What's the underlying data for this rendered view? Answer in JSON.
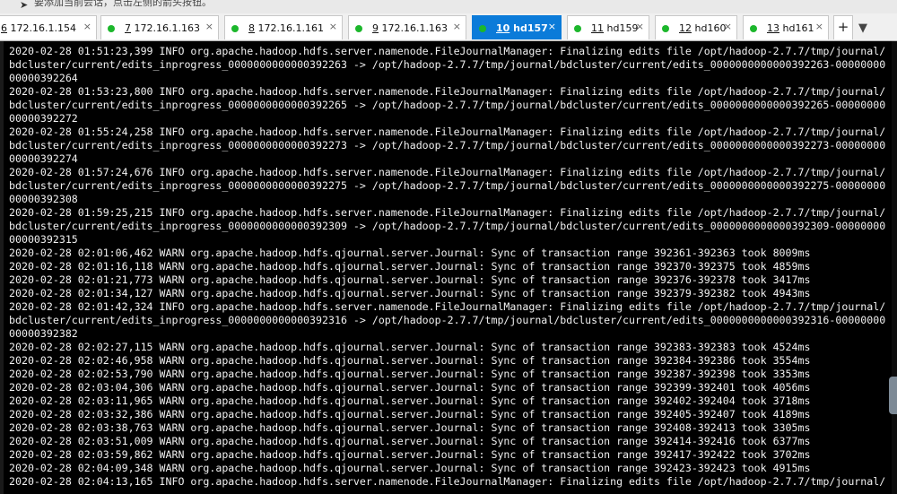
{
  "window": {
    "top_hint": "要添加当前会话，点击左侧的箭头按钮。"
  },
  "tabs": [
    {
      "num": "6",
      "name": "172.16.1.154",
      "dot": false,
      "active": false
    },
    {
      "num": "7",
      "name": "172.16.1.163",
      "dot": true,
      "active": false
    },
    {
      "num": "8",
      "name": "172.16.1.161",
      "dot": true,
      "active": false
    },
    {
      "num": "9",
      "name": "172.16.1.163",
      "dot": true,
      "active": false
    },
    {
      "num": "10",
      "name": "hd157",
      "dot": true,
      "active": true
    },
    {
      "num": "11",
      "name": "hd159",
      "dot": true,
      "active": false
    },
    {
      "num": "12",
      "name": "hd160",
      "dot": true,
      "active": false
    },
    {
      "num": "13",
      "name": "hd161",
      "dot": true,
      "active": false
    }
  ],
  "tab_close_glyph": "×",
  "add_tab_label": "+",
  "colors": {
    "active_tab": "#0b7bd9",
    "status_dot": "#1cb72c",
    "terminal_bg": "#000000",
    "terminal_fg": "#f0f0f0"
  },
  "terminal": {
    "lines": [
      "2020-02-28 01:51:23,399 INFO org.apache.hadoop.hdfs.server.namenode.FileJournalManager: Finalizing edits file /opt/hadoop-2.7.7/tmp/journal/",
      "bdcluster/current/edits_inprogress_0000000000000392263 -> /opt/hadoop-2.7.7/tmp/journal/bdcluster/current/edits_0000000000000392263-00000000",
      "00000392264",
      "2020-02-28 01:53:23,800 INFO org.apache.hadoop.hdfs.server.namenode.FileJournalManager: Finalizing edits file /opt/hadoop-2.7.7/tmp/journal/",
      "bdcluster/current/edits_inprogress_0000000000000392265 -> /opt/hadoop-2.7.7/tmp/journal/bdcluster/current/edits_0000000000000392265-00000000",
      "00000392272",
      "2020-02-28 01:55:24,258 INFO org.apache.hadoop.hdfs.server.namenode.FileJournalManager: Finalizing edits file /opt/hadoop-2.7.7/tmp/journal/",
      "bdcluster/current/edits_inprogress_0000000000000392273 -> /opt/hadoop-2.7.7/tmp/journal/bdcluster/current/edits_0000000000000392273-00000000",
      "00000392274",
      "2020-02-28 01:57:24,676 INFO org.apache.hadoop.hdfs.server.namenode.FileJournalManager: Finalizing edits file /opt/hadoop-2.7.7/tmp/journal/",
      "bdcluster/current/edits_inprogress_0000000000000392275 -> /opt/hadoop-2.7.7/tmp/journal/bdcluster/current/edits_0000000000000392275-00000000",
      "00000392308",
      "2020-02-28 01:59:25,215 INFO org.apache.hadoop.hdfs.server.namenode.FileJournalManager: Finalizing edits file /opt/hadoop-2.7.7/tmp/journal/",
      "bdcluster/current/edits_inprogress_0000000000000392309 -> /opt/hadoop-2.7.7/tmp/journal/bdcluster/current/edits_0000000000000392309-00000000",
      "00000392315",
      "2020-02-28 02:01:06,462 WARN org.apache.hadoop.hdfs.qjournal.server.Journal: Sync of transaction range 392361-392363 took 8009ms",
      "2020-02-28 02:01:16,118 WARN org.apache.hadoop.hdfs.qjournal.server.Journal: Sync of transaction range 392370-392375 took 4859ms",
      "2020-02-28 02:01:21,773 WARN org.apache.hadoop.hdfs.qjournal.server.Journal: Sync of transaction range 392376-392378 took 3417ms",
      "2020-02-28 02:01:34,127 WARN org.apache.hadoop.hdfs.qjournal.server.Journal: Sync of transaction range 392379-392382 took 4943ms",
      "2020-02-28 02:01:42,324 INFO org.apache.hadoop.hdfs.server.namenode.FileJournalManager: Finalizing edits file /opt/hadoop-2.7.7/tmp/journal/",
      "bdcluster/current/edits_inprogress_0000000000000392316 -> /opt/hadoop-2.7.7/tmp/journal/bdcluster/current/edits_0000000000000392316-00000000",
      "00000392382",
      "2020-02-28 02:02:27,115 WARN org.apache.hadoop.hdfs.qjournal.server.Journal: Sync of transaction range 392383-392383 took 4524ms",
      "2020-02-28 02:02:46,958 WARN org.apache.hadoop.hdfs.qjournal.server.Journal: Sync of transaction range 392384-392386 took 3554ms",
      "2020-02-28 02:02:53,790 WARN org.apache.hadoop.hdfs.qjournal.server.Journal: Sync of transaction range 392387-392398 took 3353ms",
      "2020-02-28 02:03:04,306 WARN org.apache.hadoop.hdfs.qjournal.server.Journal: Sync of transaction range 392399-392401 took 4056ms",
      "2020-02-28 02:03:11,965 WARN org.apache.hadoop.hdfs.qjournal.server.Journal: Sync of transaction range 392402-392404 took 3718ms",
      "2020-02-28 02:03:32,386 WARN org.apache.hadoop.hdfs.qjournal.server.Journal: Sync of transaction range 392405-392407 took 4189ms",
      "2020-02-28 02:03:38,763 WARN org.apache.hadoop.hdfs.qjournal.server.Journal: Sync of transaction range 392408-392413 took 3305ms",
      "2020-02-28 02:03:51,009 WARN org.apache.hadoop.hdfs.qjournal.server.Journal: Sync of transaction range 392414-392416 took 6377ms",
      "2020-02-28 02:03:59,862 WARN org.apache.hadoop.hdfs.qjournal.server.Journal: Sync of transaction range 392417-392422 took 3702ms",
      "2020-02-28 02:04:09,348 WARN org.apache.hadoop.hdfs.qjournal.server.Journal: Sync of transaction range 392423-392423 took 4915ms",
      "2020-02-28 02:04:13,165 INFO org.apache.hadoop.hdfs.server.namenode.FileJournalManager: Finalizing edits file /opt/hadoop-2.7.7/tmp/journal/"
    ]
  }
}
